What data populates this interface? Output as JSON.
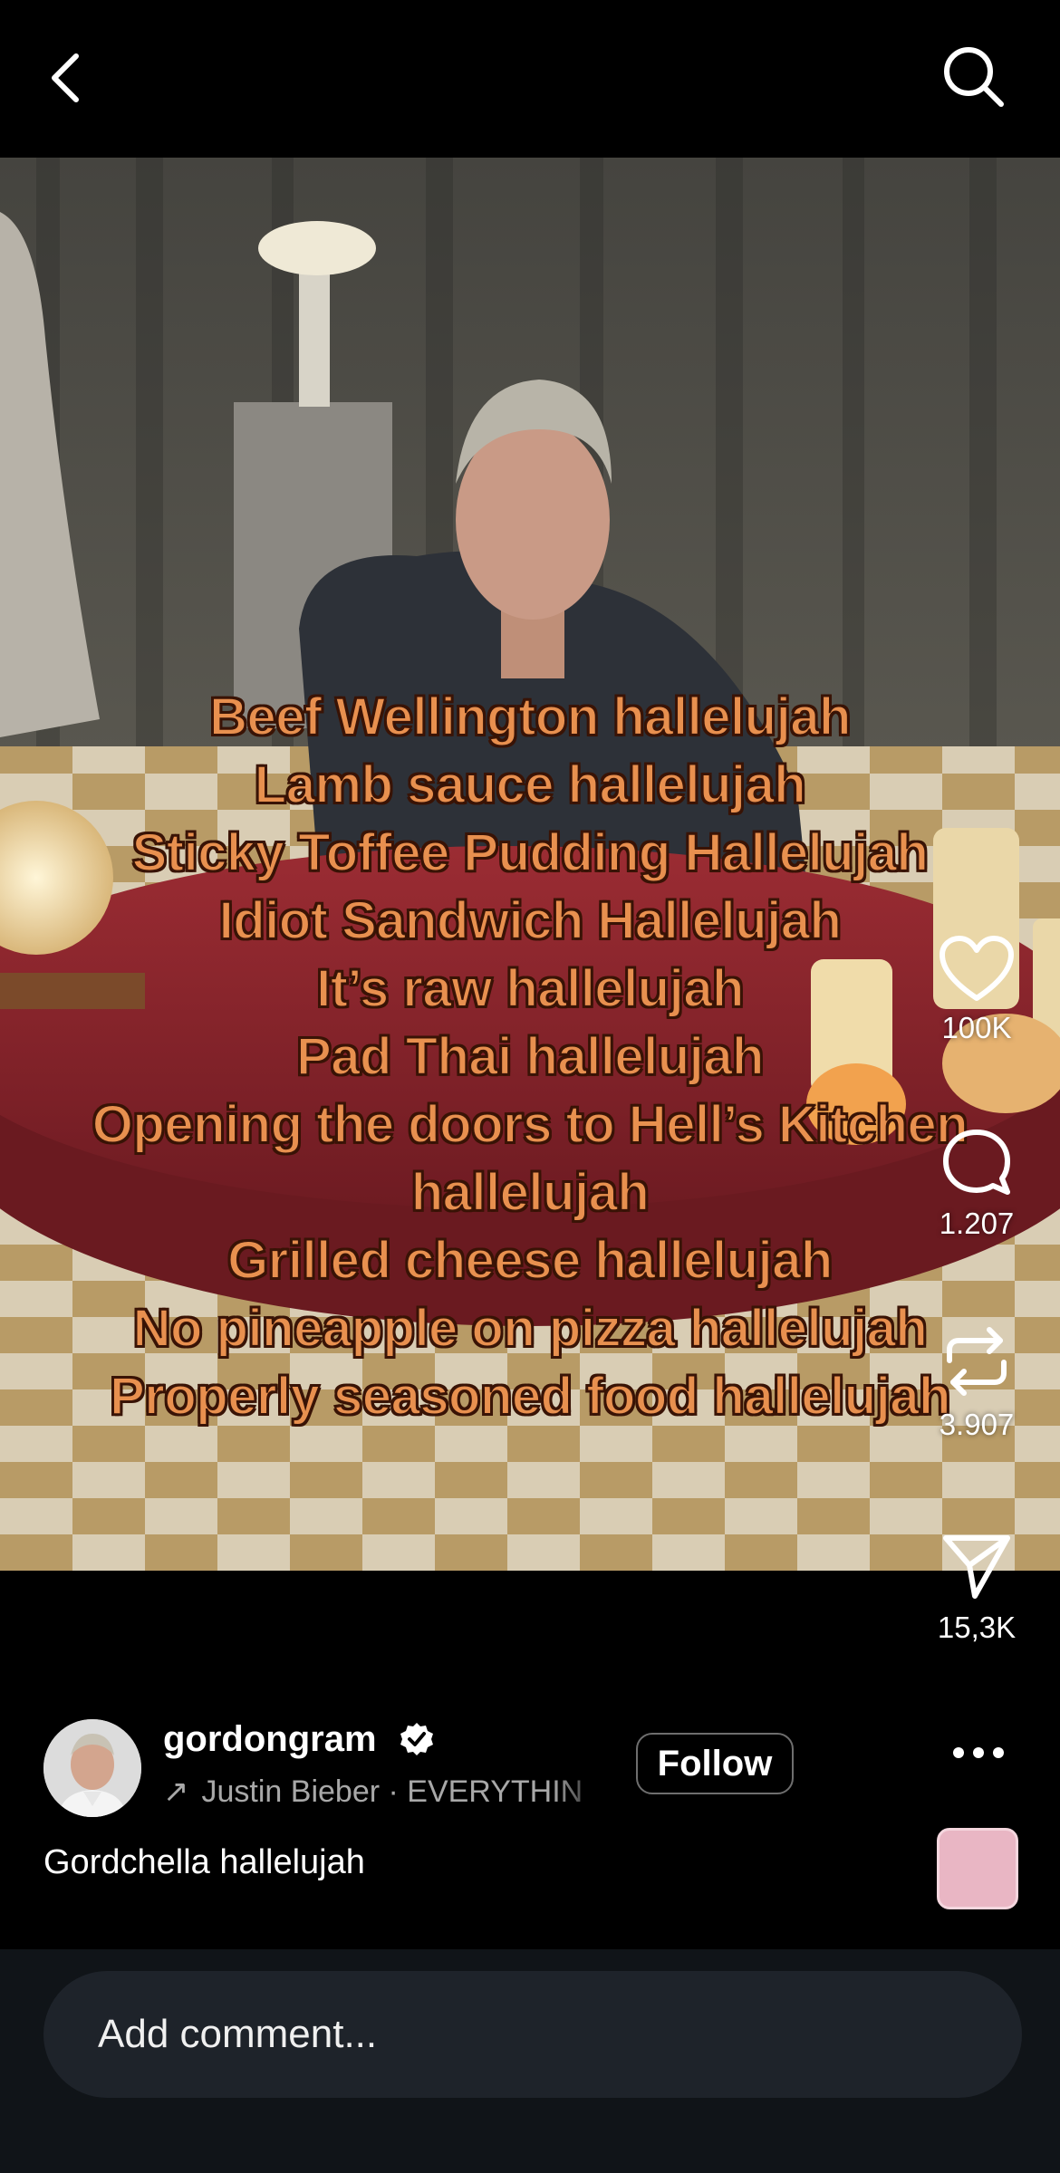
{
  "header": {
    "back_icon": "chevron-left-icon",
    "search_icon": "search-icon"
  },
  "video": {
    "overlay_lines": [
      "Beef Wellington hallelujah",
      "Lamb sauce hallelujah",
      "Sticky Toffee Pudding Hallelujah",
      "Idiot Sandwich Hallelujah",
      "It’s raw hallelujah",
      "Pad Thai hallelujah",
      "Opening the doors to Hell’s Kitchen",
      "hallelujah",
      "Grilled cheese hallelujah",
      "No pineapple on pizza hallelujah",
      "Properly seasoned food hallelujah"
    ],
    "overlay_text_color": "#e8904f"
  },
  "actions": {
    "like_count": "100K",
    "comment_count": "1.207",
    "repost_count": "3.907",
    "share_count": "15,3K"
  },
  "post": {
    "username": "gordongram",
    "verified": true,
    "music_text": "Justin Bieber · EVERYTHIN",
    "follow_label": "Follow",
    "caption": "Gordchella hallelujah"
  },
  "comment": {
    "placeholder": "Add comment..."
  }
}
